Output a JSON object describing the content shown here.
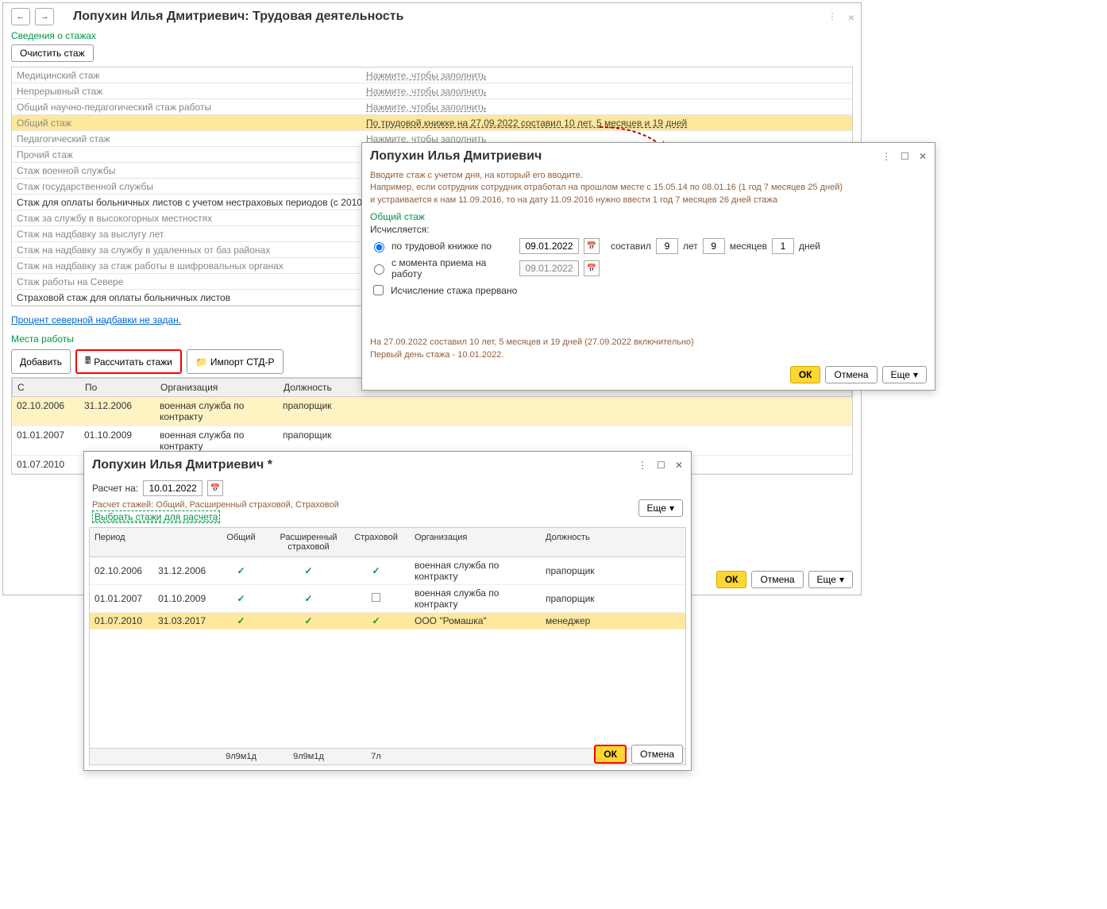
{
  "main": {
    "nav_back": "←",
    "nav_fwd": "→",
    "title": "Лопухин Илья Дмитриевич: Трудовая деятельность",
    "close": "×"
  },
  "stages": {
    "section": "Сведения о стажах",
    "clear_btn": "Очистить стаж",
    "fill_link": "Нажмите, чтобы заполнить",
    "rows": [
      {
        "label": "Медицинский стаж"
      },
      {
        "label": "Непрерывный стаж"
      },
      {
        "label": "Общий научно-педагогический стаж работы"
      },
      {
        "label": "Общий стаж",
        "value": "По трудовой книжке на 27.09.2022 составил 10 лет, 5 месяцев и 19 дней",
        "hl": true
      },
      {
        "label": "Педагогический стаж"
      },
      {
        "label": "Прочий стаж"
      },
      {
        "label": "Стаж военной службы"
      },
      {
        "label": "Стаж государственной службы"
      },
      {
        "label": "Стаж для оплаты больничных листов с учетом нестраховых периодов (с 2010 года)",
        "bold": true
      },
      {
        "label": "Стаж за службу в высокогорных местностях"
      },
      {
        "label": "Стаж на надбавку за выслугу лет"
      },
      {
        "label": "Стаж на надбавку за службу в удаленных от баз районах"
      },
      {
        "label": "Стаж на надбавку за стаж работы в шифровальных органах"
      },
      {
        "label": "Стаж работы на Севере"
      },
      {
        "label": "Страховой стаж для оплаты больничных листов",
        "bold": true
      }
    ],
    "north_link": "Процент северной надбавки не задан."
  },
  "jobs": {
    "section": "Места работы",
    "add_btn": "Добавить",
    "calc_btn": "Рассчитать стажи",
    "import_btn": "Импорт СТД-Р",
    "hdr": {
      "from": "С",
      "to": "По",
      "org": "Организация",
      "pos": "Должность"
    },
    "rows": [
      {
        "from": "02.10.2006",
        "to": "31.12.2006",
        "org": "военная служба по контракту",
        "pos": "прапорщик",
        "hl": true
      },
      {
        "from": "01.01.2007",
        "to": "01.10.2009",
        "org": "военная служба по контракту",
        "pos": "прапорщик"
      },
      {
        "from": "01.07.2010",
        "to": "31.03.2017",
        "org": "ООО \"Ромашка\"",
        "pos": "менеджер"
      }
    ]
  },
  "footer": {
    "ok": "ОК",
    "cancel": "Отмена",
    "more": "Еще"
  },
  "dlg1": {
    "title": "Лопухин Илья Дмитриевич",
    "info1": "Вводите стаж с учетом дня, на который его вводите.",
    "info2": "Например, если сотрудник сотрудник отработал на прошлом месте с 15.05.14 по 08.01.16 (1 год 7 месяцев 25 дней)",
    "info3": "и устраивается к нам 11.09.2016, то на дату 11.09.2016 нужно ввести 1 год 7 месяцев 26 дней стажа",
    "section": "Общий стаж",
    "calc_label": "Исчисляется:",
    "radio1": "по трудовой книжке по",
    "date1": "09.01.2022",
    "made": "составил",
    "y": "9",
    "ylbl": "лет",
    "m": "9",
    "mlbl": "месяцев",
    "d": "1",
    "dlbl": "дней",
    "radio2": "с момента приема на работу",
    "date2": "09.01.2022",
    "chk": "Исчисление стажа прервано",
    "status1": "На 27.09.2022 составил 10 лет, 5 месяцев и 19 дней (27.09.2022 включительно)",
    "status2": "Первый день стажа - 10.01.2022.",
    "ok": "ОК",
    "cancel": "Отмена",
    "more": "Еще"
  },
  "dlg2": {
    "title": "Лопухин Илья Дмитриевич *",
    "calc_on": "Расчет на:",
    "date": "10.01.2022",
    "summary": "Расчет стажей: Общий, Расширенный страховой, Страховой",
    "choose": "Выбрать стажи для расчета",
    "more": "Еще",
    "hdr": {
      "per": "Период",
      "gen": "Общий",
      "ext": "Расширенный страховой",
      "ins": "Страховой",
      "org": "Организация",
      "pos": "Должность"
    },
    "rows": [
      {
        "from": "02.10.2006",
        "to": "31.12.2006",
        "gen": true,
        "ext": true,
        "ins": true,
        "org": "военная служба по контракту",
        "pos": "прапорщик"
      },
      {
        "from": "01.01.2007",
        "to": "01.10.2009",
        "gen": true,
        "ext": true,
        "ins": false,
        "org": "военная служба по контракту",
        "pos": "прапорщик"
      },
      {
        "from": "01.07.2010",
        "to": "31.03.2017",
        "gen": true,
        "ext": true,
        "ins": true,
        "org": "ООО \"Ромашка\"",
        "pos": "менеджер",
        "hl": true
      }
    ],
    "footer": {
      "gen": "9л9м1д",
      "ext": "9л9м1д",
      "ins": "7л"
    },
    "ok": "ОК",
    "cancel": "Отмена"
  }
}
